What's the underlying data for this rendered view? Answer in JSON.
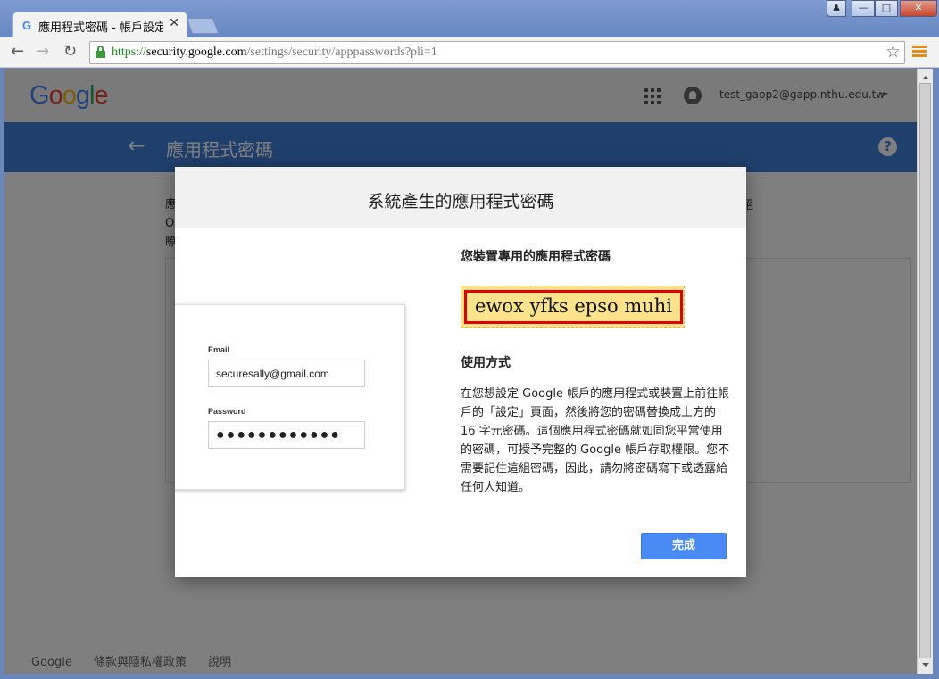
{
  "browser": {
    "tab_title": "應用程式密碼 - 帳戶設定",
    "tab_favicon": "G",
    "url_scheme": "https://",
    "url_host": "security.google.com",
    "url_path": "/settings/security/apppasswords?pli=1",
    "close_glyph": "✕",
    "back_glyph": "←",
    "forward_glyph": "→",
    "reload_glyph": "↻",
    "star_glyph": "☆"
  },
  "header": {
    "logo": [
      "G",
      "o",
      "o",
      "g",
      "l",
      "e"
    ],
    "logo_colors": [
      "#4285f4",
      "#ea4335",
      "#fbbc05",
      "#4285f4",
      "#34a853",
      "#ea4335"
    ],
    "account": "test_gapp2@gapp.nthu.edu.tw"
  },
  "bluebar": {
    "back_glyph": "←",
    "title": "應用程式密碼",
    "help_glyph": "?"
  },
  "background": {
    "text_line1": "應",
    "text_line2": "O",
    "text_line3": "瞭",
    "text_right": "絕"
  },
  "dialog": {
    "title": "系統產生的應用程式密碼",
    "sample": {
      "email_label": "Email",
      "email_value": "securesally@gmail.com",
      "password_label": "Password",
      "password_value": "●●●●●●●●●●●●"
    },
    "device_heading": "您裝置專用的應用程式密碼",
    "app_password": "ewox yfks epso muhi",
    "usage_heading": "使用方式",
    "usage_text": "在您想設定 Google 帳戶的應用程式或裝置上前往帳戶的「設定」頁面，然後將您的密碼替換成上方的 16 字元密碼。這個應用程式密碼就如同您平常使用的密碼，可授予完整的 Google 帳戶存取權限。您不需要記住這組密碼，因此，請勿將密碼寫下或透露給任何人知道。",
    "done_label": "完成"
  },
  "footer": {
    "google": "Google",
    "terms": "條款與隱私權政策",
    "help": "說明"
  },
  "colors": {
    "brand_blue": "#3f7fd8",
    "button_blue": "#4a8af4",
    "highlight_yellow": "#fbe38b",
    "highlight_border": "#e00000"
  }
}
